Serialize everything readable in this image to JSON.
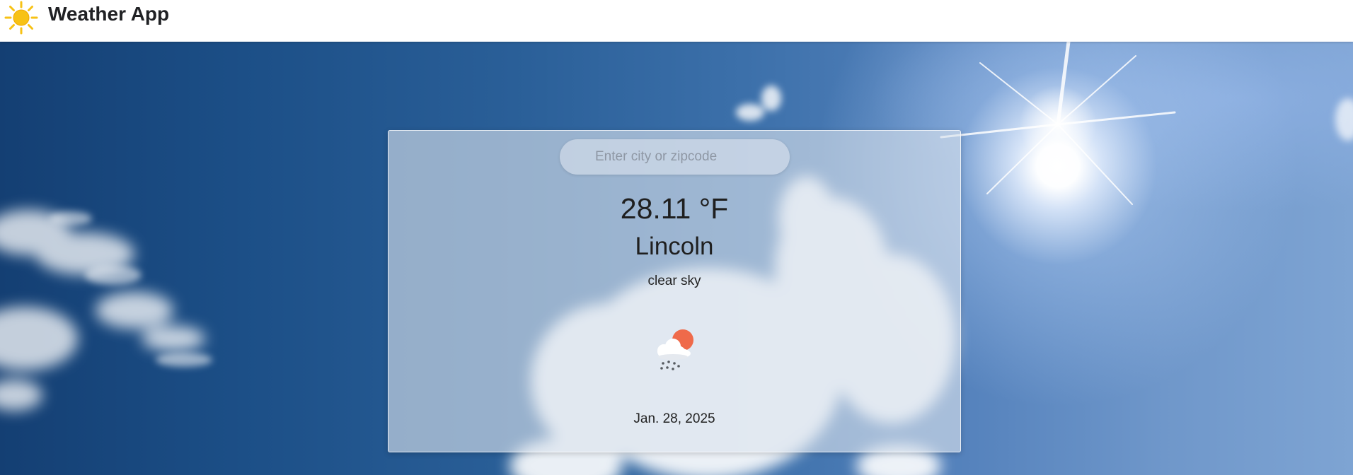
{
  "header": {
    "logo_icon": "sun-icon",
    "title": "Weather App"
  },
  "search": {
    "value": "",
    "placeholder": "Enter city or zipcode"
  },
  "weather": {
    "temperature": "28.11 °F",
    "city": "Lincoln",
    "description": "clear sky",
    "icon": "cloud-rain-sun-icon",
    "date": "Jan. 28, 2025"
  },
  "colors": {
    "sun_yellow": "#f7c215",
    "sun_orange": "#ef6a4a",
    "sky_blue": "#1c4f87",
    "text_dark": "#1f1f1f"
  }
}
